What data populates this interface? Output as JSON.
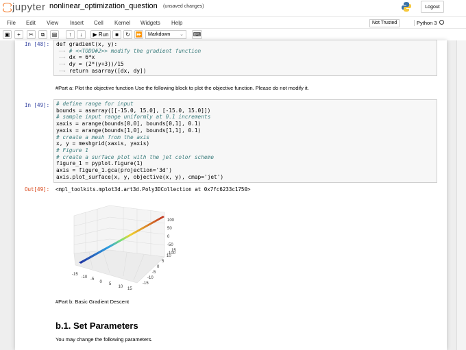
{
  "header": {
    "logo": "jupyter",
    "notebook_name": "nonlinear_optimization_question",
    "status": "(unsaved changes)",
    "logout": "Logout"
  },
  "menu": [
    "File",
    "Edit",
    "View",
    "Insert",
    "Cell",
    "Kernel",
    "Widgets",
    "Help"
  ],
  "trust": "Not Trusted",
  "kernel": "Python 3",
  "toolbar": {
    "run": "Run",
    "cell_type": "Markdown"
  },
  "cells": {
    "c48_prompt": "In [48]:",
    "c48_code": [
      "def gradient(x, y):",
      "    # <<TODO#2>> modify the gradient function",
      "    dx = 6*x",
      "    dy = (2*(y+3))/15",
      "    return asarray([dx, dy])"
    ],
    "md_a": "#Part a: Plot the objective function Use the following block to plot the objective function. Please do not modify it.",
    "c49_prompt": "In [49]:",
    "c49_code": [
      "# define range for input",
      "bounds = asarray([[-15.0, 15.0], [-15.0, 15.0]])",
      "# sample input range uniformly at 0.1 increments",
      "xaxis = arange(bounds[0,0], bounds[0,1], 0.1)",
      "yaxis = arange(bounds[1,0], bounds[1,1], 0.1)",
      "# create a mesh from the axis",
      "x, y = meshgrid(xaxis, yaxis)",
      "# Figure 1",
      "# create a surface plot with the jet color scheme",
      "figure_1 = pyplot.figure(1)",
      "axis = figure_1.gca(projection='3d')",
      "axis.plot_surface(x, y, objective(x, y), cmap='jet')"
    ],
    "out49_prompt": "Out[49]:",
    "out49_text": "<mpl_toolkits.mplot3d.art3d.Poly3DCollection at 0x7fc6233c1750>",
    "md_b": "#Part b: Basic Gradient Descent",
    "h_b1": "b.1. Set Parameters",
    "md_b1": "You may change the following parameters."
  },
  "chart_data": {
    "type": "surface3d",
    "colormap": "jet",
    "x_ticks": [
      "-15",
      "-10",
      "-5",
      "0",
      "5",
      "10",
      "15"
    ],
    "y_ticks": [
      "-15",
      "-10",
      "-5",
      "0",
      "5",
      "10",
      "15"
    ],
    "z_ticks": [
      "100",
      "50",
      "0",
      "-50",
      "-100"
    ],
    "xlim": [
      -15,
      15
    ],
    "ylim": [
      -15,
      15
    ],
    "zlim": [
      -120,
      120
    ]
  }
}
